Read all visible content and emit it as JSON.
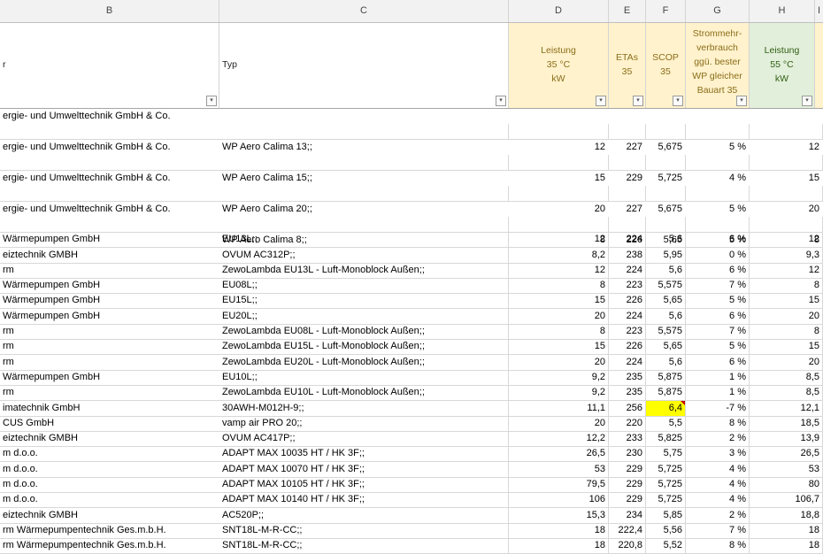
{
  "columns": [
    "B",
    "C",
    "D",
    "E",
    "F",
    "G",
    "H",
    "I"
  ],
  "headers": {
    "b": "r",
    "c": "Typ",
    "d": [
      "Leistung",
      "35 °C",
      "kW"
    ],
    "e": [
      "ETAs",
      "35"
    ],
    "f": [
      "SCOP",
      "35"
    ],
    "g": [
      "Strommehr-",
      "verbrauch",
      "ggü. bester",
      "WP gleicher",
      "Bauart 35"
    ],
    "h": [
      "Leistung",
      "55 °C",
      "kW"
    ]
  },
  "colors": {
    "yellow_header": "#fff2cc",
    "green_header": "#e2efda",
    "highlight": "#ffff00",
    "column_header_bg": "#f2f2f2"
  },
  "rows": [
    {
      "b": "ergie- und Umwelttechnik GmbH & Co.",
      "c": "WP Aero Calima 13;;",
      "d": "12",
      "e": "227",
      "f": "5,675",
      "g": "5 %",
      "h": "12",
      "tall": true
    },
    {
      "b": "ergie- und Umwelttechnik GmbH & Co.",
      "c": "WP Aero Calima 15;;",
      "d": "15",
      "e": "229",
      "f": "5,725",
      "g": "4 %",
      "h": "15",
      "tall": true
    },
    {
      "b": "ergie- und Umwelttechnik GmbH & Co.",
      "c": "WP Aero Calima 20;;",
      "d": "20",
      "e": "227",
      "f": "5,675",
      "g": "5 %",
      "h": "20",
      "tall": true
    },
    {
      "b": "ergie- und Umwelttechnik GmbH & Co.",
      "c": "WP Aero Calima 8;;",
      "d": "8",
      "e": "226",
      "f": "5,65",
      "g": "5 %",
      "h": "8",
      "tall": true
    },
    {
      "b": " Wärmepumpen GmbH",
      "c": "EU13L;;",
      "d": "12",
      "e": "224",
      "f": "5,6",
      "g": "6 %",
      "h": "12"
    },
    {
      "b": "eiztechnik GMBH",
      "c": "OVUM AC312P;;",
      "d": "8,2",
      "e": "238",
      "f": "5,95",
      "g": "0 %",
      "h": "9,3"
    },
    {
      "b": "rm",
      "c": "ZewoLambda EU13L - Luft-Monoblock Außen;;",
      "d": "12",
      "e": "224",
      "f": "5,6",
      "g": "6 %",
      "h": "12"
    },
    {
      "b": " Wärmepumpen GmbH",
      "c": "EU08L;;",
      "d": "8",
      "e": "223",
      "f": "5,575",
      "g": "7 %",
      "h": "8"
    },
    {
      "b": " Wärmepumpen GmbH",
      "c": "EU15L;;",
      "d": "15",
      "e": "226",
      "f": "5,65",
      "g": "5 %",
      "h": "15"
    },
    {
      "b": " Wärmepumpen GmbH",
      "c": "EU20L;;",
      "d": "20",
      "e": "224",
      "f": "5,6",
      "g": "6 %",
      "h": "20"
    },
    {
      "b": "rm",
      "c": "ZewoLambda EU08L - Luft-Monoblock Außen;;",
      "d": "8",
      "e": "223",
      "f": "5,575",
      "g": "7 %",
      "h": "8"
    },
    {
      "b": "rm",
      "c": "ZewoLambda EU15L - Luft-Monoblock Außen;;",
      "d": "15",
      "e": "226",
      "f": "5,65",
      "g": "5 %",
      "h": "15"
    },
    {
      "b": "rm",
      "c": "ZewoLambda EU20L - Luft-Monoblock Außen;;",
      "d": "20",
      "e": "224",
      "f": "5,6",
      "g": "6 %",
      "h": "20"
    },
    {
      "b": " Wärmepumpen GmbH",
      "c": "EU10L;;",
      "d": "9,2",
      "e": "235",
      "f": "5,875",
      "g": "1 %",
      "h": "8,5"
    },
    {
      "b": "rm",
      "c": "ZewoLambda EU10L - Luft-Monoblock Außen;;",
      "d": "9,2",
      "e": "235",
      "f": "5,875",
      "g": "1 %",
      "h": "8,5"
    },
    {
      "b": "imatechnik GmbH",
      "c": "30AWH-M012H-9;;",
      "d": "11,1",
      "e": "256",
      "f": "6,4",
      "g": "-7 %",
      "h": "12,1",
      "highlight": true
    },
    {
      "b": "CUS GmbH",
      "c": "vamp air PRO 20;;",
      "d": "20",
      "e": "220",
      "f": "5,5",
      "g": "8 %",
      "h": "18,5"
    },
    {
      "b": "eiztechnik GMBH",
      "c": "OVUM AC417P;;",
      "d": "12,2",
      "e": "233",
      "f": "5,825",
      "g": "2 %",
      "h": "13,9"
    },
    {
      "b": "m d.o.o.",
      "c": "ADAPT MAX 10035 HT / HK 3F;;",
      "d": "26,5",
      "e": "230",
      "f": "5,75",
      "g": "3 %",
      "h": "26,5"
    },
    {
      "b": "m d.o.o.",
      "c": "ADAPT MAX 10070 HT / HK 3F;;",
      "d": "53",
      "e": "229",
      "f": "5,725",
      "g": "4 %",
      "h": "53"
    },
    {
      "b": "m d.o.o.",
      "c": "ADAPT MAX 10105 HT / HK 3F;;",
      "d": "79,5",
      "e": "229",
      "f": "5,725",
      "g": "4 %",
      "h": "80"
    },
    {
      "b": "m d.o.o.",
      "c": "ADAPT MAX 10140 HT / HK 3F;;",
      "d": "106",
      "e": "229",
      "f": "5,725",
      "g": "4 %",
      "h": "106,7"
    },
    {
      "b": "eiztechnik GMBH",
      "c": "AC520P;;",
      "d": "15,3",
      "e": "234",
      "f": "5,85",
      "g": "2 %",
      "h": "18,8"
    },
    {
      "b": "rm Wärmepumpentechnik Ges.m.b.H.",
      "c": "SNT18L-M-R-CC;;",
      "d": "18",
      "e": "222,4",
      "f": "5,56",
      "g": "7 %",
      "h": "18"
    },
    {
      "b": "rm Wärmepumpentechnik Ges.m.b.H.",
      "c": "SNT18L-M-R-CC;;",
      "d": "18",
      "e": "220,8",
      "f": "5,52",
      "g": "8 %",
      "h": "18"
    }
  ]
}
